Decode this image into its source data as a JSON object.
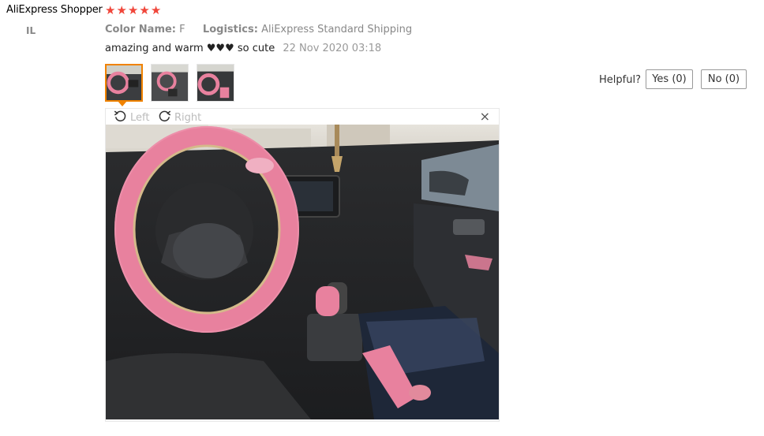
{
  "review": {
    "user_name": "AliExpress Shopper",
    "country": "IL",
    "rating": 5,
    "color_label": "Color Name:",
    "color_value": "F",
    "logistics_label": "Logistics:",
    "logistics_value": "AliExpress Standard Shipping",
    "text": "amazing and warm ♥♥♥ so cute",
    "date": "22 Nov 2020 03:18"
  },
  "helpful": {
    "label": "Helpful?",
    "yes_label": "Yes (0)",
    "no_label": "No (0)"
  },
  "viewer": {
    "left_label": "Left",
    "right_label": "Right",
    "close_glyph": "×"
  },
  "colors": {
    "star": "#f0463a",
    "active_thumb_border": "#f08200",
    "fur_pink": "#e8819e"
  },
  "icons": [
    "star-icon",
    "rotate-left-icon",
    "rotate-right-icon",
    "close-icon"
  ]
}
